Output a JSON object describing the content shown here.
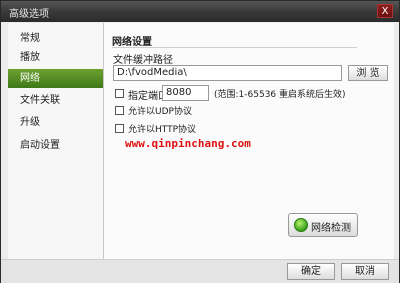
{
  "window": {
    "title": "高级选项",
    "close_label": "X"
  },
  "sidebar": {
    "items": [
      {
        "label": "常规"
      },
      {
        "label": "播放"
      },
      {
        "label": "网络"
      },
      {
        "label": "文件关联"
      },
      {
        "label": "升级"
      },
      {
        "label": "启动设置"
      }
    ],
    "active_index": 2,
    "active_color": "#5a9a2a"
  },
  "network": {
    "section_title": "网络设置",
    "cache_path_label": "文件缓冲路径",
    "cache_path_value": "D:\\fvodMedia\\",
    "browse_label": "浏 览",
    "port_checkbox_label": "指定端口",
    "port_value": "8080",
    "port_hint": "(范围:1-65536 重启系统后生效)",
    "udp_label": "允许以UDP协议",
    "http_label": "允许以HTTP协议",
    "detect_button_label": "网络检测"
  },
  "watermark": "www.qinpinchang.com",
  "footer": {
    "ok_label": "确定",
    "cancel_label": "取消"
  }
}
